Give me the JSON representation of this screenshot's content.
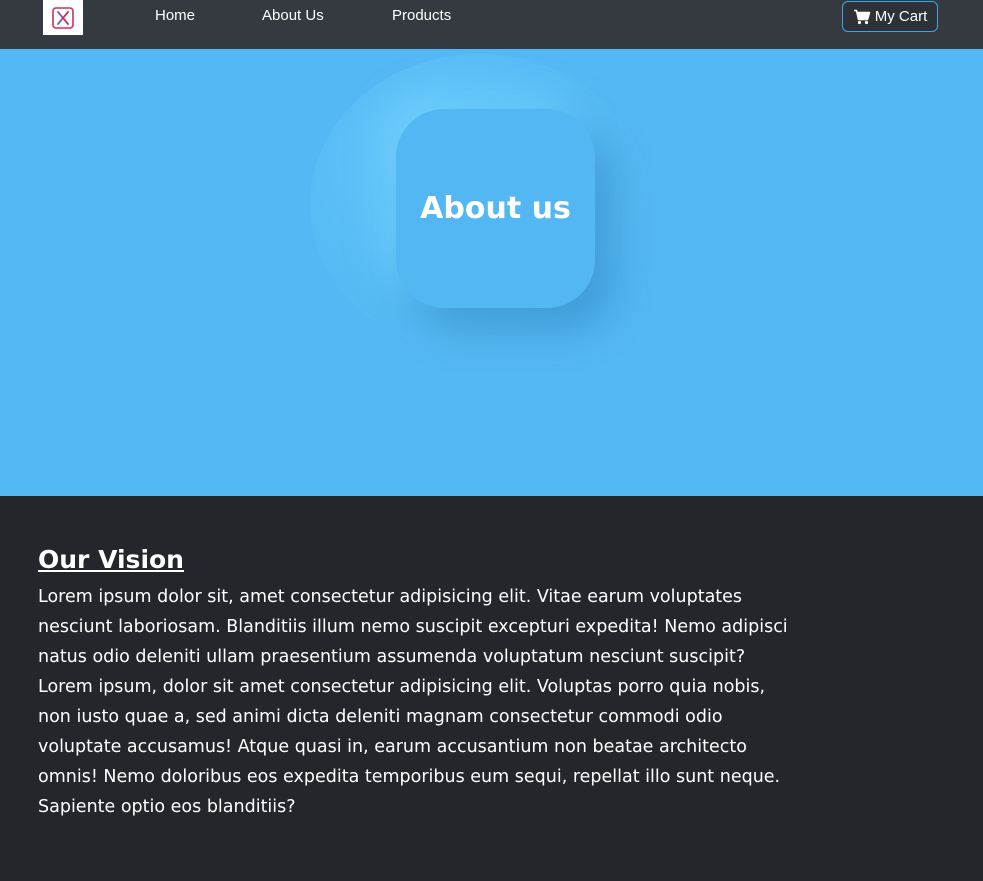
{
  "nav": {
    "logo_label": "X",
    "links": [
      "Home",
      "About Us",
      "Products"
    ],
    "cart_label": "My Cart",
    "cart_icon": "cart-icon"
  },
  "hero": {
    "title": "About us"
  },
  "vision": {
    "title": "Our Vision",
    "paragraphs": [
      "Lorem ipsum dolor sit, amet consectetur adipisicing elit. Vitae earum voluptates nesciunt laboriosam. Blanditiis illum nemo suscipit excepturi expedita! Nemo adipisci natus odio deleniti ullam praesentium assumenda voluptatum nesciunt suscipit?",
      "Lorem ipsum, dolor sit amet consectetur adipisicing elit. Voluptas porro quia nobis, non iusto quae a, sed animi dicta deleniti magnam consectetur commodi odio voluptate accusamus! Atque quasi in, earum accusantium non beatae architecto omnis! Nemo doloribus eos expedita temporibus eum sequi, repellat illo sunt neque. Sapiente optio eos blanditiis?"
    ]
  },
  "colors": {
    "navbar": "#343a40",
    "hero": "#54b8f4",
    "body": "#24262b",
    "accent": "#3aa7e8"
  }
}
